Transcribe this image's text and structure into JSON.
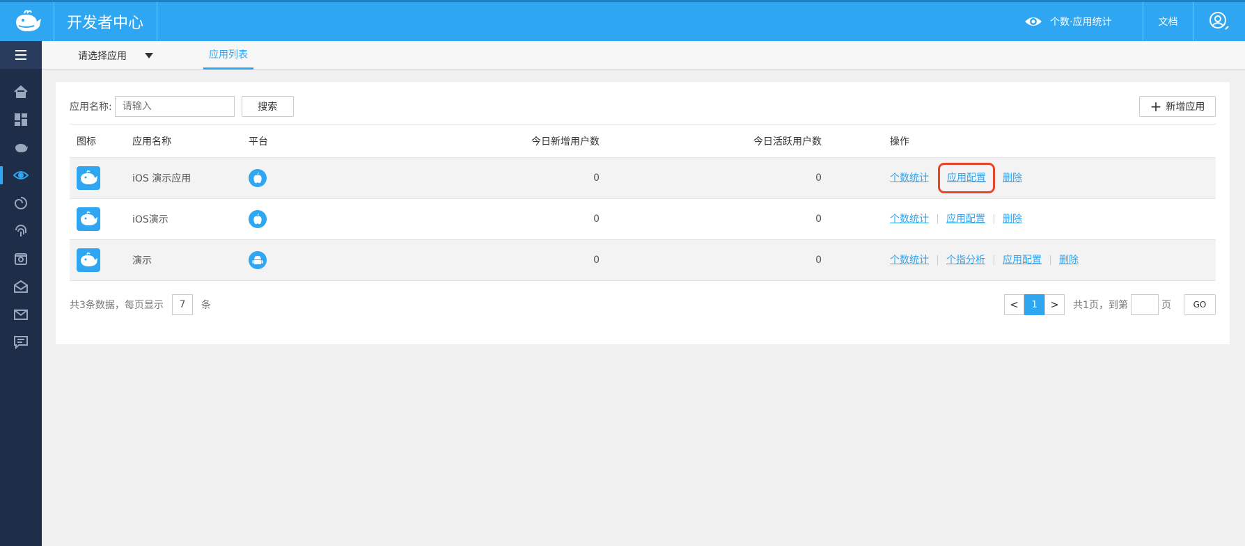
{
  "header": {
    "title": "开发者中心",
    "stat_label": "个数·应用统计",
    "doc_label": "文档",
    "logo_icon": "whale-logo-icon",
    "user_icon": "user-icon"
  },
  "sidebar": {
    "menu_icon": "hamburger-icon",
    "items": [
      {
        "icon": "home-icon"
      },
      {
        "icon": "dashboard-icon"
      },
      {
        "icon": "whale-icon"
      },
      {
        "icon": "eye-icon",
        "active": true
      },
      {
        "icon": "swirl-icon"
      },
      {
        "icon": "fingerprint-icon"
      },
      {
        "icon": "device-icon"
      },
      {
        "icon": "mail-open-icon"
      },
      {
        "icon": "mail-icon"
      },
      {
        "icon": "message-icon"
      }
    ]
  },
  "subbar": {
    "app_select": "请选择应用",
    "tab_label": "应用列表"
  },
  "search": {
    "label": "应用名称:",
    "placeholder": "请输入",
    "button": "搜索"
  },
  "add_button": "新增应用",
  "table": {
    "headers": {
      "icon": "图标",
      "name": "应用名称",
      "platform": "平台",
      "new_users": "今日新增用户数",
      "active_users": "今日活跃用户数",
      "ops": "操作"
    },
    "rows": [
      {
        "name": "iOS 演示应用",
        "platform": "apple",
        "new_users": "0",
        "active_users": "0",
        "ops": [
          "个数统计",
          "应用配置",
          "删除"
        ]
      },
      {
        "name": "iOS演示",
        "platform": "apple",
        "new_users": "0",
        "active_users": "0",
        "ops": [
          "个数统计",
          "应用配置",
          "删除"
        ]
      },
      {
        "name": "演示",
        "platform": "android",
        "new_users": "0",
        "active_users": "0",
        "ops": [
          "个数统计",
          "个指分析",
          "应用配置",
          "删除"
        ]
      }
    ]
  },
  "pagination": {
    "summary_prefix": "共3条数据，每页显示",
    "page_size": "7",
    "summary_suffix": "条",
    "prev": "<",
    "current": "1",
    "next": ">",
    "total_pages": "共1页，到第",
    "page_suffix": "页",
    "go": "GO"
  },
  "colors": {
    "primary": "#2fa6f2",
    "sidebar": "#1e2d48",
    "highlight": "#e8442a"
  }
}
